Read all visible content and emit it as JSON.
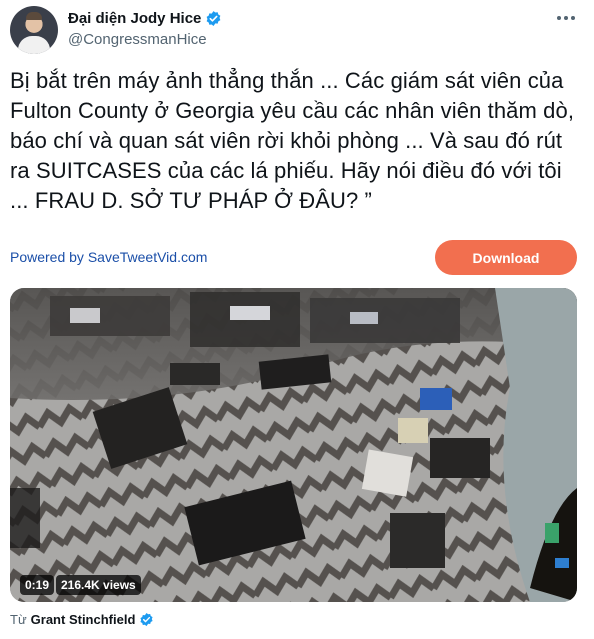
{
  "author": {
    "display_name": "Đại diện Jody Hice",
    "handle": "@CongressmanHice",
    "avatar_icon": "profile-photo",
    "verified_icon": "verified-badge-icon"
  },
  "menu_icon": "more-options-icon",
  "tweet": {
    "text": "Bị bắt trên máy ảnh thẳng thắn ... Các giám sát viên của Fulton County ở Georgia yêu cầu các nhân viên thăm dò, báo chí và quan sát viên rời khỏi phòng ... Và sau đó rút ra SUITCASES của các lá phiếu. Hãy nói điều đó với tôi ... FRAU D. SỞ TƯ PHÁP Ở ĐÂU? ”"
  },
  "savetweet": {
    "powered_label": "Powered by SaveTweetVid.com",
    "download_label": "Download",
    "download_color": "#f26f4f"
  },
  "video": {
    "duration": "0:19",
    "views": "216.4K views"
  },
  "source": {
    "prefix": "Từ",
    "author": "Grant Stinchfield"
  },
  "colors": {
    "text": "#0f1419",
    "muted": "#536471",
    "link": "#1b4fa8",
    "verified": "#1d9bf0"
  }
}
